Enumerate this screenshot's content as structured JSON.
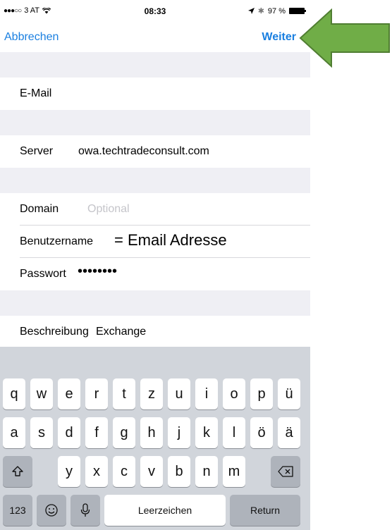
{
  "status_bar": {
    "carrier": "3 AT",
    "time": "08:33",
    "battery_text": "97 %"
  },
  "nav": {
    "cancel_label": "Abbrechen",
    "next_label": "Weiter"
  },
  "form": {
    "email_label": "E-Mail",
    "server_label": "Server",
    "server_value": "owa.techtradeconsult.com",
    "domain_label": "Domain",
    "domain_placeholder": "Optional",
    "username_label": "Benutzername",
    "username_note": "= Email Adresse",
    "password_label": "Passwort",
    "password_value": "••••••••",
    "description_label": "Beschreibung",
    "description_value": "Exchange"
  },
  "keyboard": {
    "row1": [
      "q",
      "w",
      "e",
      "r",
      "t",
      "z",
      "u",
      "i",
      "o",
      "p",
      "ü"
    ],
    "row2": [
      "a",
      "s",
      "d",
      "f",
      "g",
      "h",
      "j",
      "k",
      "l",
      "ö",
      "ä"
    ],
    "row3": [
      "y",
      "x",
      "c",
      "v",
      "b",
      "n",
      "m"
    ],
    "numbers_label": "123",
    "space_label": "Leerzeichen",
    "return_label": "Return"
  },
  "colors": {
    "accent": "#1a7fe0",
    "arrow": "#70ad47"
  }
}
